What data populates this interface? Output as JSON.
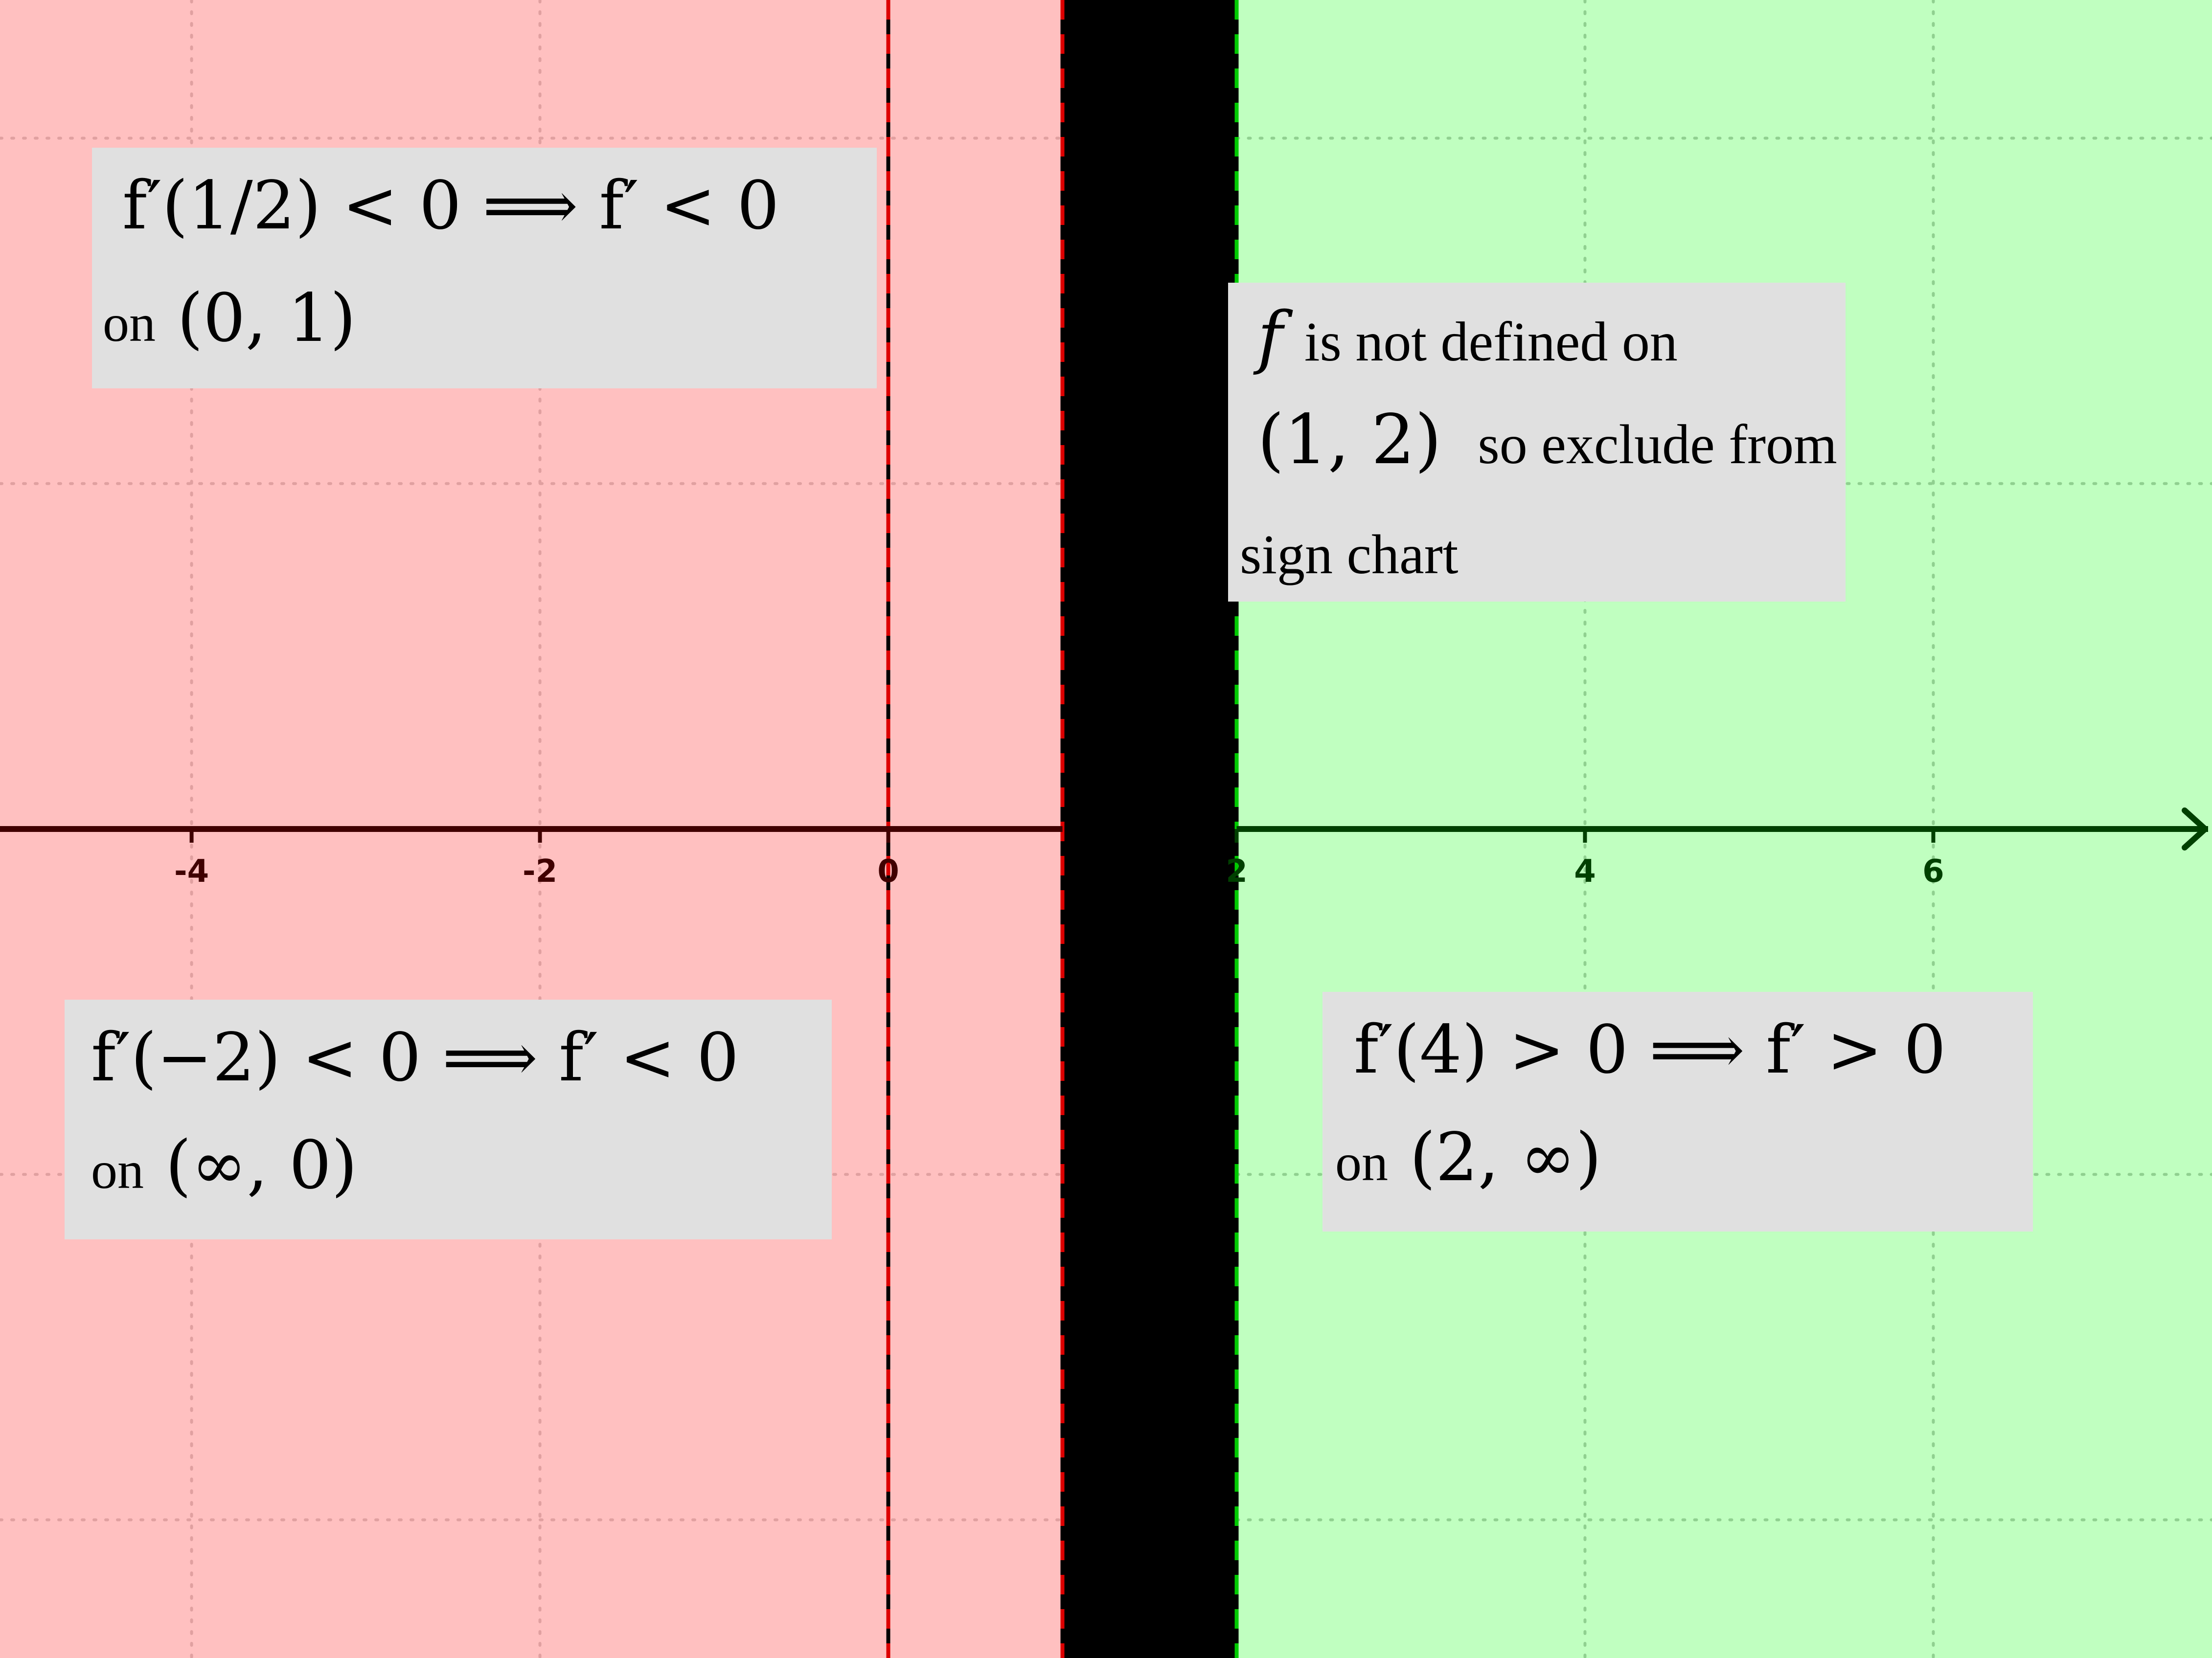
{
  "colors": {
    "negative_region": "#ffc0c0",
    "positive_region": "#c0ffc0",
    "excluded_region": "#000000",
    "negative_axis": "#400000",
    "positive_axis": "#004000",
    "negative_grid": "#e0a0a0",
    "positive_grid": "#90d090",
    "box_fill": "#e0e0e0"
  },
  "chart_data": {
    "type": "sign-chart",
    "x_range": [
      -5.1,
      7.6
    ],
    "y_range": [
      -2.4,
      2.4
    ],
    "grid": true,
    "x_ticks": [
      "-4",
      "-2",
      "0",
      "2",
      "4",
      "6"
    ],
    "regions": [
      {
        "from": -5.1,
        "to": 1,
        "sign": "negative"
      },
      {
        "from": 1,
        "to": 2,
        "sign": "excluded"
      },
      {
        "from": 2,
        "to": 7.6,
        "sign": "positive"
      }
    ],
    "dashed_lines": [
      0,
      1,
      2
    ]
  },
  "annotations": {
    "box_01": {
      "line1": "f′(1/2) < 0  ⟹  f′ < 0",
      "line2_text": "on",
      "line2_math": "(0, 1)"
    },
    "box_neg": {
      "line1": "f′(−2) < 0  ⟹  f′ < 0",
      "line2_text": "on",
      "line2_math": "(∞, 0)"
    },
    "box_pos": {
      "line1": "f′(4) > 0  ⟹  f′ > 0",
      "line2_text": "on",
      "line2_math": "(2, ∞)"
    },
    "box_undef": {
      "f": "f",
      "text1": "is not defined on",
      "interval": "(1, 2)",
      "text2": "so exclude from",
      "text3": "sign chart"
    }
  }
}
